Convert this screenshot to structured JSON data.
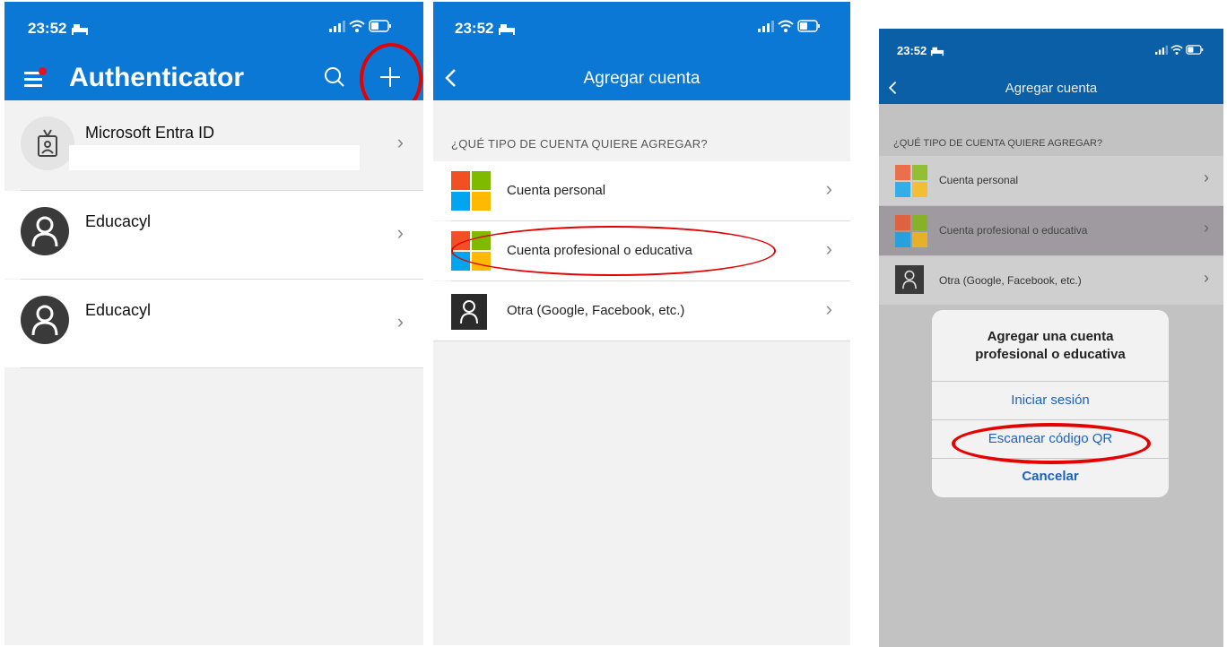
{
  "status": {
    "time": "23:52"
  },
  "screen1": {
    "title": "Authenticator",
    "accounts": [
      {
        "name": "Microsoft Entra ID"
      },
      {
        "name": "Educacyl"
      },
      {
        "name": "Educacyl"
      }
    ],
    "icons": {
      "menu": "hamburger-menu-icon",
      "search": "search-icon",
      "add": "plus-icon"
    }
  },
  "screen2": {
    "title": "Agregar cuenta",
    "section_header": "¿QUÉ TIPO DE CUENTA QUIERE AGREGAR?",
    "options": [
      {
        "label": "Cuenta personal"
      },
      {
        "label": "Cuenta profesional o educativa"
      },
      {
        "label": "Otra (Google, Facebook, etc.)"
      }
    ]
  },
  "screen3": {
    "title": "Agregar cuenta",
    "section_header": "¿QUÉ TIPO DE CUENTA QUIERE AGREGAR?",
    "options": [
      {
        "label": "Cuenta personal"
      },
      {
        "label": "Cuenta profesional o educativa"
      },
      {
        "label": "Otra (Google, Facebook, etc.)"
      }
    ],
    "dialog": {
      "title": "Agregar una cuenta profesional o educativa",
      "actions": [
        "Iniciar sesión",
        "Escanear código QR",
        "Cancelar"
      ]
    }
  },
  "colors": {
    "accent": "#0a78d4",
    "highlight": "#e60000",
    "ms_red": "#f25022",
    "ms_green": "#7fba00",
    "ms_blue": "#00a4ef",
    "ms_yellow": "#ffb900"
  }
}
